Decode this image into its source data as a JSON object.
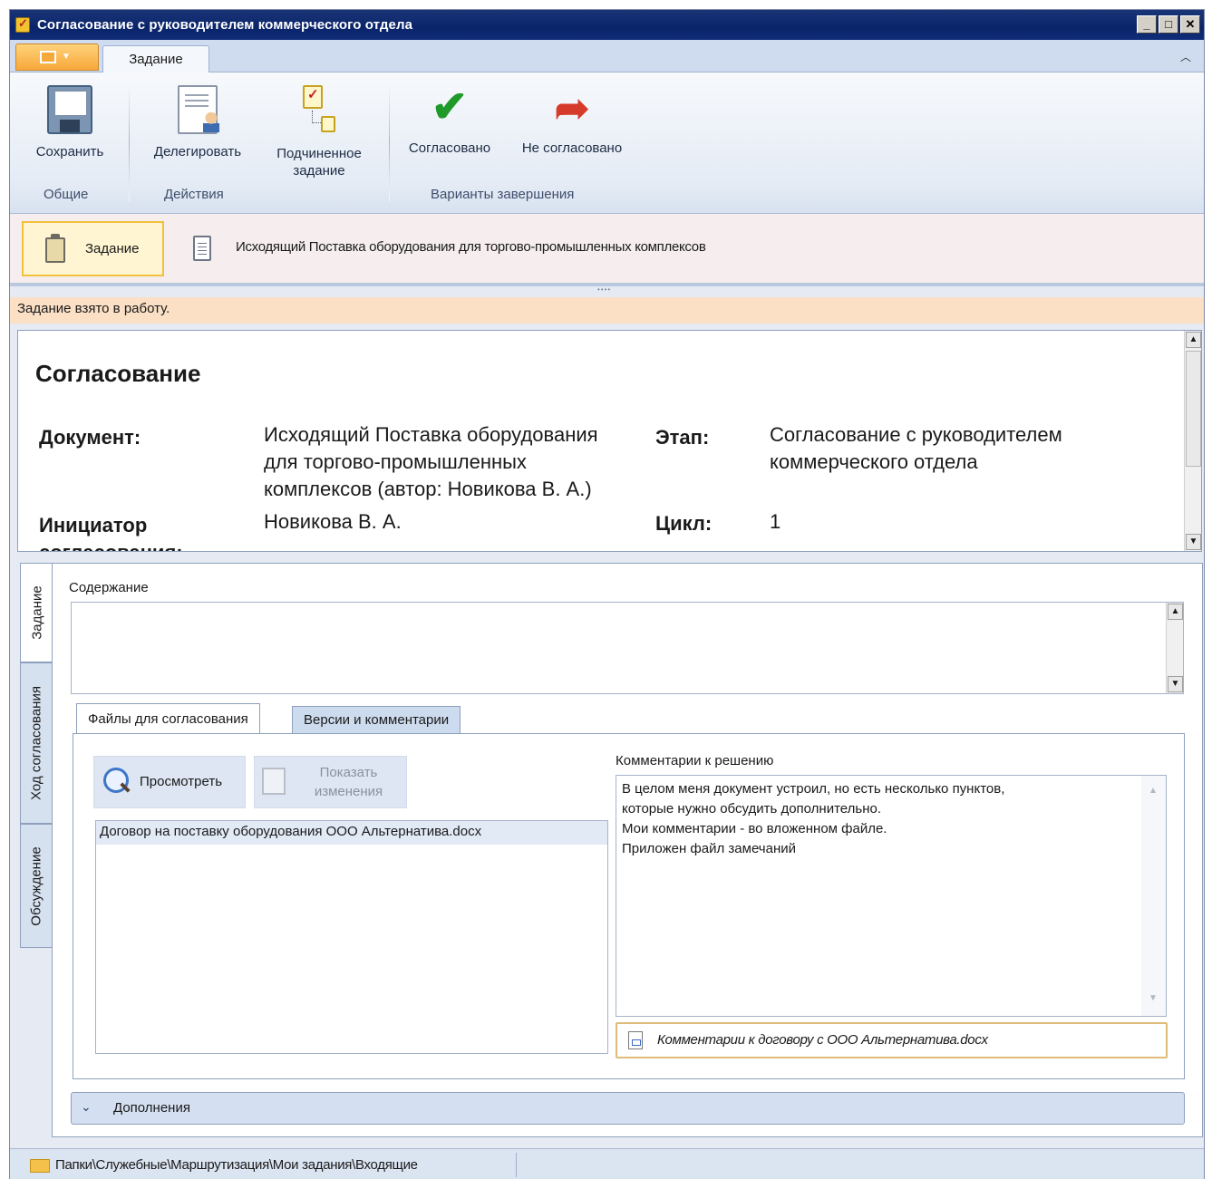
{
  "window": {
    "title": "Согласование с руководителем коммерческого отдела",
    "controls": {
      "minimize": "_",
      "maximize": "□",
      "close": "✕"
    }
  },
  "ribbon": {
    "tab": "Задание",
    "buttons": {
      "save": "Сохранить",
      "delegate": "Делегировать",
      "subtask_line1": "Подчиненное",
      "subtask_line2": "задание",
      "approved": "Согласовано",
      "not_approved": "Не согласовано"
    },
    "groups": {
      "general": "Общие",
      "actions": "Действия",
      "completion": "Варианты завершения"
    }
  },
  "doc_tabs": {
    "task": "Задание",
    "document": "Исходящий Поставка оборудования для торгово-промышленных комплексов"
  },
  "status": "Задание взято в работу.",
  "info": {
    "heading": "Согласование",
    "document_label": "Документ:",
    "document_value_lines": [
      "Исходящий Поставка оборудования",
      "для торгово-промышленных",
      "комплексов (автор: Новикова В. А.)"
    ],
    "stage_label": "Этап:",
    "stage_value_lines": [
      "Согласование с руководителем",
      "коммерческого отдела"
    ],
    "initiator_label_line1": "Инициатор",
    "initiator_label_line2": "согласования:",
    "initiator_value": "Новикова В. А.",
    "cycle_label": "Цикл:",
    "cycle_value": "1"
  },
  "side_tabs": [
    "Задание",
    "Ход согласования",
    "Обсуждение"
  ],
  "task_tab": {
    "content_label": "Содержание",
    "content_value": "",
    "inner_tabs": [
      "Файлы для согласования",
      "Версии и комментарии"
    ],
    "view_button": "Просмотреть",
    "changes_button_line1": "Показать",
    "changes_button_line2": "изменения",
    "files": [
      "Договор на поставку оборудования ООО Альтернатива.docx"
    ],
    "comments_label": "Комментарии к решению",
    "comments_lines": [
      "В целом меня документ устроил, но есть несколько пунктов,",
      "которые нужно обсудить дополнительно.",
      "Мои комментарии - во вложенном файле.",
      "Приложен файл замечаний"
    ],
    "attachment": "Комментарии к договору с ООО Альтернатива.docx",
    "addons": "Дополнения"
  },
  "footer": {
    "path": "Папки\\Служебные\\Маршрутизация\\Мои задания\\Входящие"
  },
  "colors": {
    "title_bar": "#0a246a",
    "status_bg": "#fbe0c6",
    "active_tab_border": "#f2c13c",
    "approve_green": "#1f9a2a",
    "reject_red": "#d63a2a"
  }
}
